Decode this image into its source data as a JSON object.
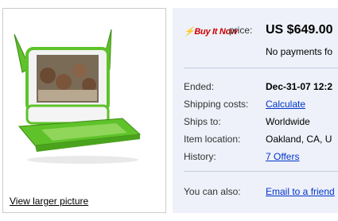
{
  "listing": {
    "view_larger_label": "View larger picture",
    "buy_it_now": "Buy It Now",
    "price_label": "price:",
    "price_value": "US $649.00",
    "payment_note": "No payments fo",
    "ended_label": "Ended:",
    "ended_value": "Dec-31-07 12:2",
    "shipping_label": "Shipping costs:",
    "shipping_value": "Calculate",
    "ships_to_label": "Ships to:",
    "ships_to_value": "Worldwide",
    "location_label": "Item location:",
    "location_value": "Oakland, CA, U",
    "history_label": "History:",
    "history_value": "7 Offers",
    "also_label": "You can also:",
    "also_value": "Email to a friend"
  },
  "colors": {
    "laptop_green": "#5fc22a",
    "panel_bg": "#eef1f9",
    "link_blue": "#0033cc",
    "brand_red": "#cc0000"
  }
}
